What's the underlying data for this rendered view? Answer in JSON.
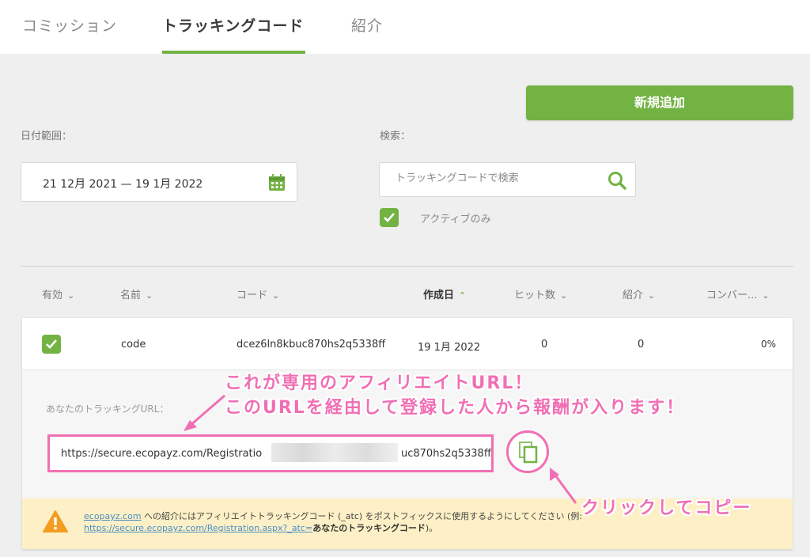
{
  "tabs": [
    {
      "label": "コミッション"
    },
    {
      "label": "トラッキングコード"
    },
    {
      "label": "紹介"
    }
  ],
  "add_button": "新規追加",
  "filters": {
    "date_label": "日付範囲：",
    "date_value": "21 12月 2021 — 19 1月 2022",
    "search_label": "検索：",
    "search_placeholder": "トラッキングコードで検索",
    "active_only_label": "アクティブのみ"
  },
  "table": {
    "headers": [
      "有効",
      "名前",
      "コード",
      "作成日",
      "ヒット数",
      "紹介",
      "コンバー..."
    ],
    "row": {
      "name": "code",
      "code": "dcez6ln8kbuc870hs2q5338ff",
      "created": "19 1月 2022",
      "hits": "0",
      "referrals": "0",
      "conversion": "0%"
    }
  },
  "tracking": {
    "label": "あなたのトラッキングURL：",
    "url_start": "https://secure.ecopayz.com/Registratio",
    "url_end": "uc870hs2q5338ff"
  },
  "notice": {
    "link1": "ecopayz.com",
    "text1": " への紹介にはアフィリエイトトラッキングコード (_atc) をポストフィックスに使用するようにしてください (例:",
    "link2": "https://secure.ecopayz.com/Registration.aspx?_atc=",
    "bold": "あなたのトラッキングコード",
    "text2": ")。"
  },
  "annotations": {
    "line1": "これが専用のアフィリエイトURL！",
    "line2": "このURLを経由して登録した人から報酬が入ります！",
    "copy_hint": "クリックしてコピー"
  },
  "colors": {
    "accent": "#73b343",
    "highlight": "#f06fb4",
    "warning_bg": "#fdf0c6",
    "warning_icon": "#f39c1f"
  }
}
